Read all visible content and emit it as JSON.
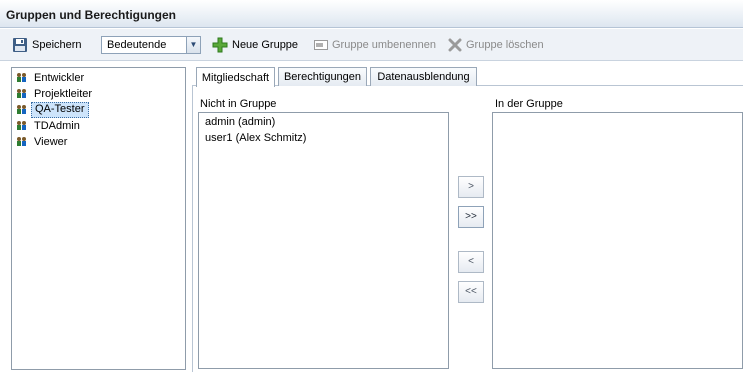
{
  "window": {
    "title": "Gruppen und Berechtigungen"
  },
  "toolbar": {
    "save_label": "Speichern",
    "filter_value": "Bedeutende",
    "new_group_label": "Neue Gruppe",
    "rename_group_label": "Gruppe umbenennen",
    "delete_group_label": "Gruppe löschen"
  },
  "groups": [
    {
      "label": "Entwickler",
      "selected": false
    },
    {
      "label": "Projektleiter",
      "selected": false
    },
    {
      "label": "QA-Tester",
      "selected": true
    },
    {
      "label": "TDAdmin",
      "selected": false
    },
    {
      "label": "Viewer",
      "selected": false
    }
  ],
  "tabs": [
    {
      "label": "Mitgliedschaft",
      "active": true
    },
    {
      "label": "Berechtigungen",
      "active": false
    },
    {
      "label": "Datenausblendung",
      "active": false
    }
  ],
  "membership": {
    "not_in_group_label": "Nicht in Gruppe",
    "in_group_label": "In der Gruppe",
    "not_in_group": [
      "admin (admin)",
      "user1 (Alex Schmitz)"
    ],
    "in_group": [],
    "buttons": {
      "add_one": ">",
      "add_all": ">>",
      "remove_one": "<",
      "remove_all": "<<"
    }
  }
}
